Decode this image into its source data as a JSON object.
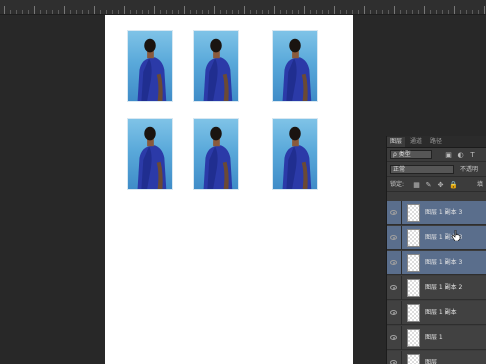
{
  "layers_panel": {
    "tabs": [
      "图层",
      "通道",
      "路径"
    ],
    "filter_kind": "ρ 类型",
    "blend_mode": "正常",
    "opacity_label": "不透明",
    "lock_label": "锁定:",
    "fill_label": "填",
    "layers": [
      {
        "name": "图层 1 副本 3",
        "selected": true
      },
      {
        "name": "图层 1 副本 3",
        "selected": true
      },
      {
        "name": "图层 1 副本 3",
        "selected": true
      },
      {
        "name": "图层 1 副本 2",
        "selected": false
      },
      {
        "name": "图层 1 副本",
        "selected": false
      },
      {
        "name": "图层 1",
        "selected": false
      },
      {
        "name": "图层",
        "selected": false
      }
    ]
  },
  "canvas": {
    "photo_count": 6,
    "document_color": "#ffffff",
    "sky_color": "#6fb8e2",
    "shirt_color": "#2a3fa6"
  },
  "colors": {
    "workspace": "#282828",
    "panel_bg": "#3c3c3c",
    "selection": "#5a6e8c"
  }
}
